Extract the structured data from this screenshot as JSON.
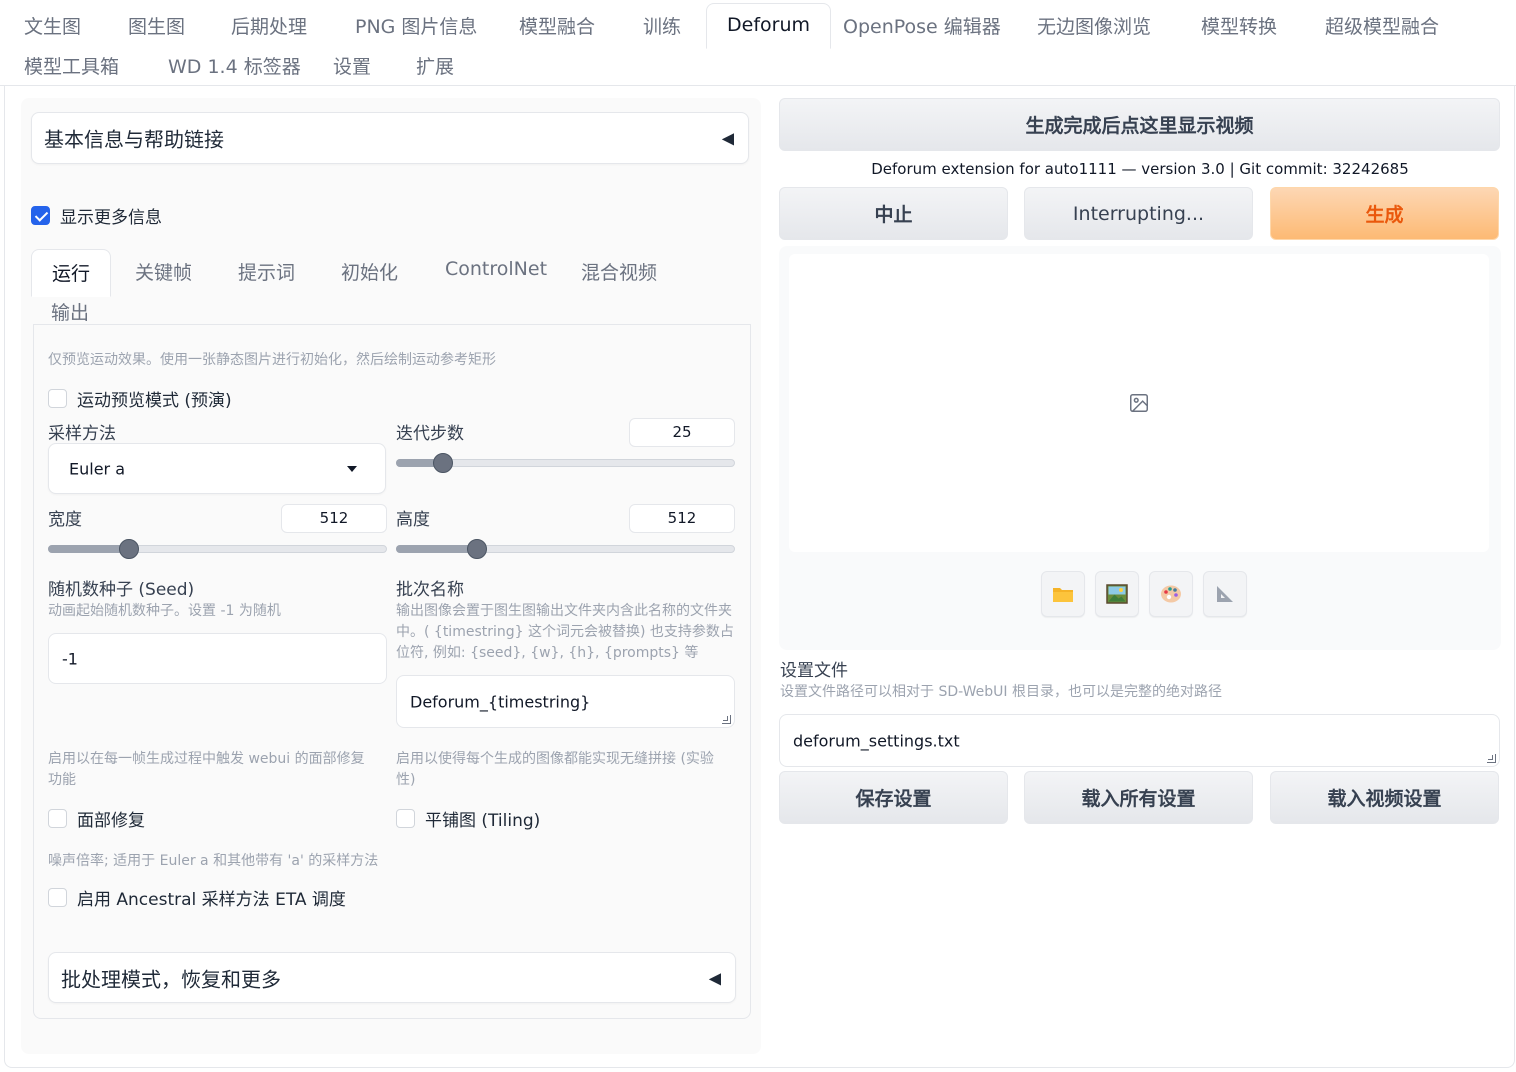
{
  "top_tabs": [
    "文生图",
    "图生图",
    "后期处理",
    "PNG 图片信息",
    "模型融合",
    "训练",
    "Deforum",
    "OpenPose 编辑器",
    "无边图像浏览",
    "模型转换",
    "超级模型融合",
    "模型工具箱",
    "WD 1.4 标签器",
    "设置",
    "扩展"
  ],
  "active_top_tab": "Deforum",
  "left": {
    "info_accordion": "基本信息与帮助链接",
    "show_more_info": {
      "label": "显示更多信息",
      "checked": true
    },
    "subtabs": [
      "运行",
      "关键帧",
      "提示词",
      "初始化",
      "ControlNet",
      "混合视频",
      "输出"
    ],
    "active_subtab": "运行",
    "run": {
      "motion_preview_hint": "仅预览运动效果。使用一张静态图片进行初始化，然后绘制运动参考矩形",
      "motion_preview": {
        "label": "运动预览模式 (预演)",
        "checked": false
      },
      "sampler": {
        "label": "采样方法",
        "value": "Euler a"
      },
      "steps": {
        "label": "迭代步数",
        "value": "25",
        "fraction": 0.14
      },
      "width": {
        "label": "宽度",
        "value": "512",
        "fraction": 0.24
      },
      "height": {
        "label": "高度",
        "value": "512",
        "fraction": 0.24
      },
      "seed": {
        "label": "随机数种子 (Seed)",
        "hint": "动画起始随机数种子。设置 -1 为随机",
        "value": "-1"
      },
      "batch_name": {
        "label": "批次名称",
        "hint": "输出图像会置于图生图输出文件夹内含此名称的文件夹中。( {timestring} 这个词元会被替换) 也支持参数占位符, 例如: {seed}, {w}, {h}, {prompts} 等",
        "value": "Deforum_{timestring}"
      },
      "face_restore_hint": "启用以在每一帧生成过程中触发 webui 的面部修复功能",
      "face_restore": {
        "label": "面部修复",
        "checked": false
      },
      "tiling_hint": "启用以使得每个生成的图像都能实现无缝拼接 (实验性)",
      "tiling": {
        "label": "平铺图 (Tiling)",
        "checked": false
      },
      "eta_hint": "噪声倍率; 适用于 Euler a 和其他带有 'a' 的采样方法",
      "eta": {
        "label": "启用 Ancestral 采样方法 ETA 调度",
        "checked": false
      },
      "batch_accordion": "批处理模式，恢复和更多"
    }
  },
  "right": {
    "show_video_button": "生成完成后点这里显示视频",
    "version_text": "Deforum extension for auto1111 — version 3.0 | Git commit: 32242685",
    "stop_button": "中止",
    "interrupt_button": "Interrupting...",
    "generate_button": "生成",
    "tool_icons": [
      "folder-icon",
      "picture-icon",
      "palette-icon",
      "ruler-icon"
    ],
    "settings_file": {
      "label": "设置文件",
      "hint": "设置文件路径可以相对于 SD-WebUI 根目录，也可以是完整的绝对路径",
      "value": "deforum_settings.txt"
    },
    "save_button": "保存设置",
    "load_all_button": "载入所有设置",
    "load_video_button": "载入视频设置"
  },
  "colors": {
    "accent_blue": "#2563eb",
    "primary_orange": "#ea580c",
    "primary_bg": "#fdba74"
  }
}
